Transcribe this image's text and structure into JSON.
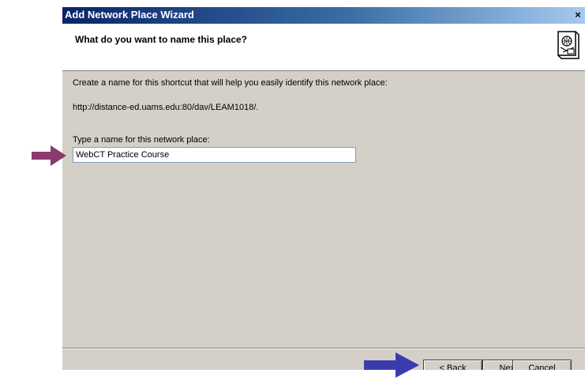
{
  "window": {
    "title": "Add Network Place Wizard",
    "close_glyph": "×"
  },
  "header": {
    "title": "What do you want to name this place?",
    "icon": "network-place-icon"
  },
  "content": {
    "instruction": "Create a name for this shortcut that will help you easily identify this network place:",
    "url": "http://distance-ed.uams.edu:80/dav/LEAM1018/.",
    "name_label": "Type a name for this network place:",
    "name_value": "WebCT Practice Course"
  },
  "buttons": {
    "back": "< Back",
    "next": "Next >",
    "cancel": "Cancel"
  },
  "annotations": {
    "input_arrow_color": "#8b3a6e",
    "button_arrow_color": "#3b3bb0"
  },
  "colors": {
    "titlebar": "#0a246a",
    "dialog_bg": "#d4d0c8"
  }
}
